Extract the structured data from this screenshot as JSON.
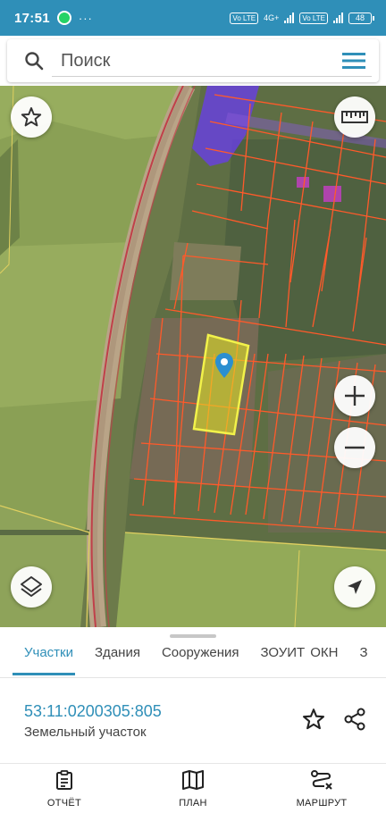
{
  "status_bar": {
    "time": "17:51",
    "dots": "···",
    "sim1": "Vo LTE",
    "network": "4G+",
    "sim2": "Vo LTE",
    "battery": "48"
  },
  "search": {
    "placeholder": "Поиск"
  },
  "map": {
    "buttons": [
      "star-icon",
      "ruler-icon",
      "zoom-in-icon",
      "zoom-out-icon",
      "layers-icon",
      "navigation-icon"
    ],
    "colors": {
      "parcel_border": "#ff5a2a",
      "selected_parcel": "#e8e822",
      "marker": "#2b8fd0",
      "okn_zone": "#6a3cf0"
    }
  },
  "sheet": {
    "tabs": [
      {
        "label": "Участки"
      },
      {
        "label": "Здания"
      },
      {
        "label": "Сооружения"
      },
      {
        "label": "ЗОУИТ"
      },
      {
        "label": "ОКН"
      },
      {
        "label": "З"
      }
    ],
    "parcel": {
      "number": "53:11:0200305:805",
      "type": "Земельный участок"
    }
  },
  "bottom_nav": [
    {
      "label": "ОТЧЁТ",
      "icon": "report-icon"
    },
    {
      "label": "ПЛАН",
      "icon": "map-icon"
    },
    {
      "label": "МАРШРУТ",
      "icon": "route-icon"
    }
  ],
  "accent_color": "#2f8fb8"
}
